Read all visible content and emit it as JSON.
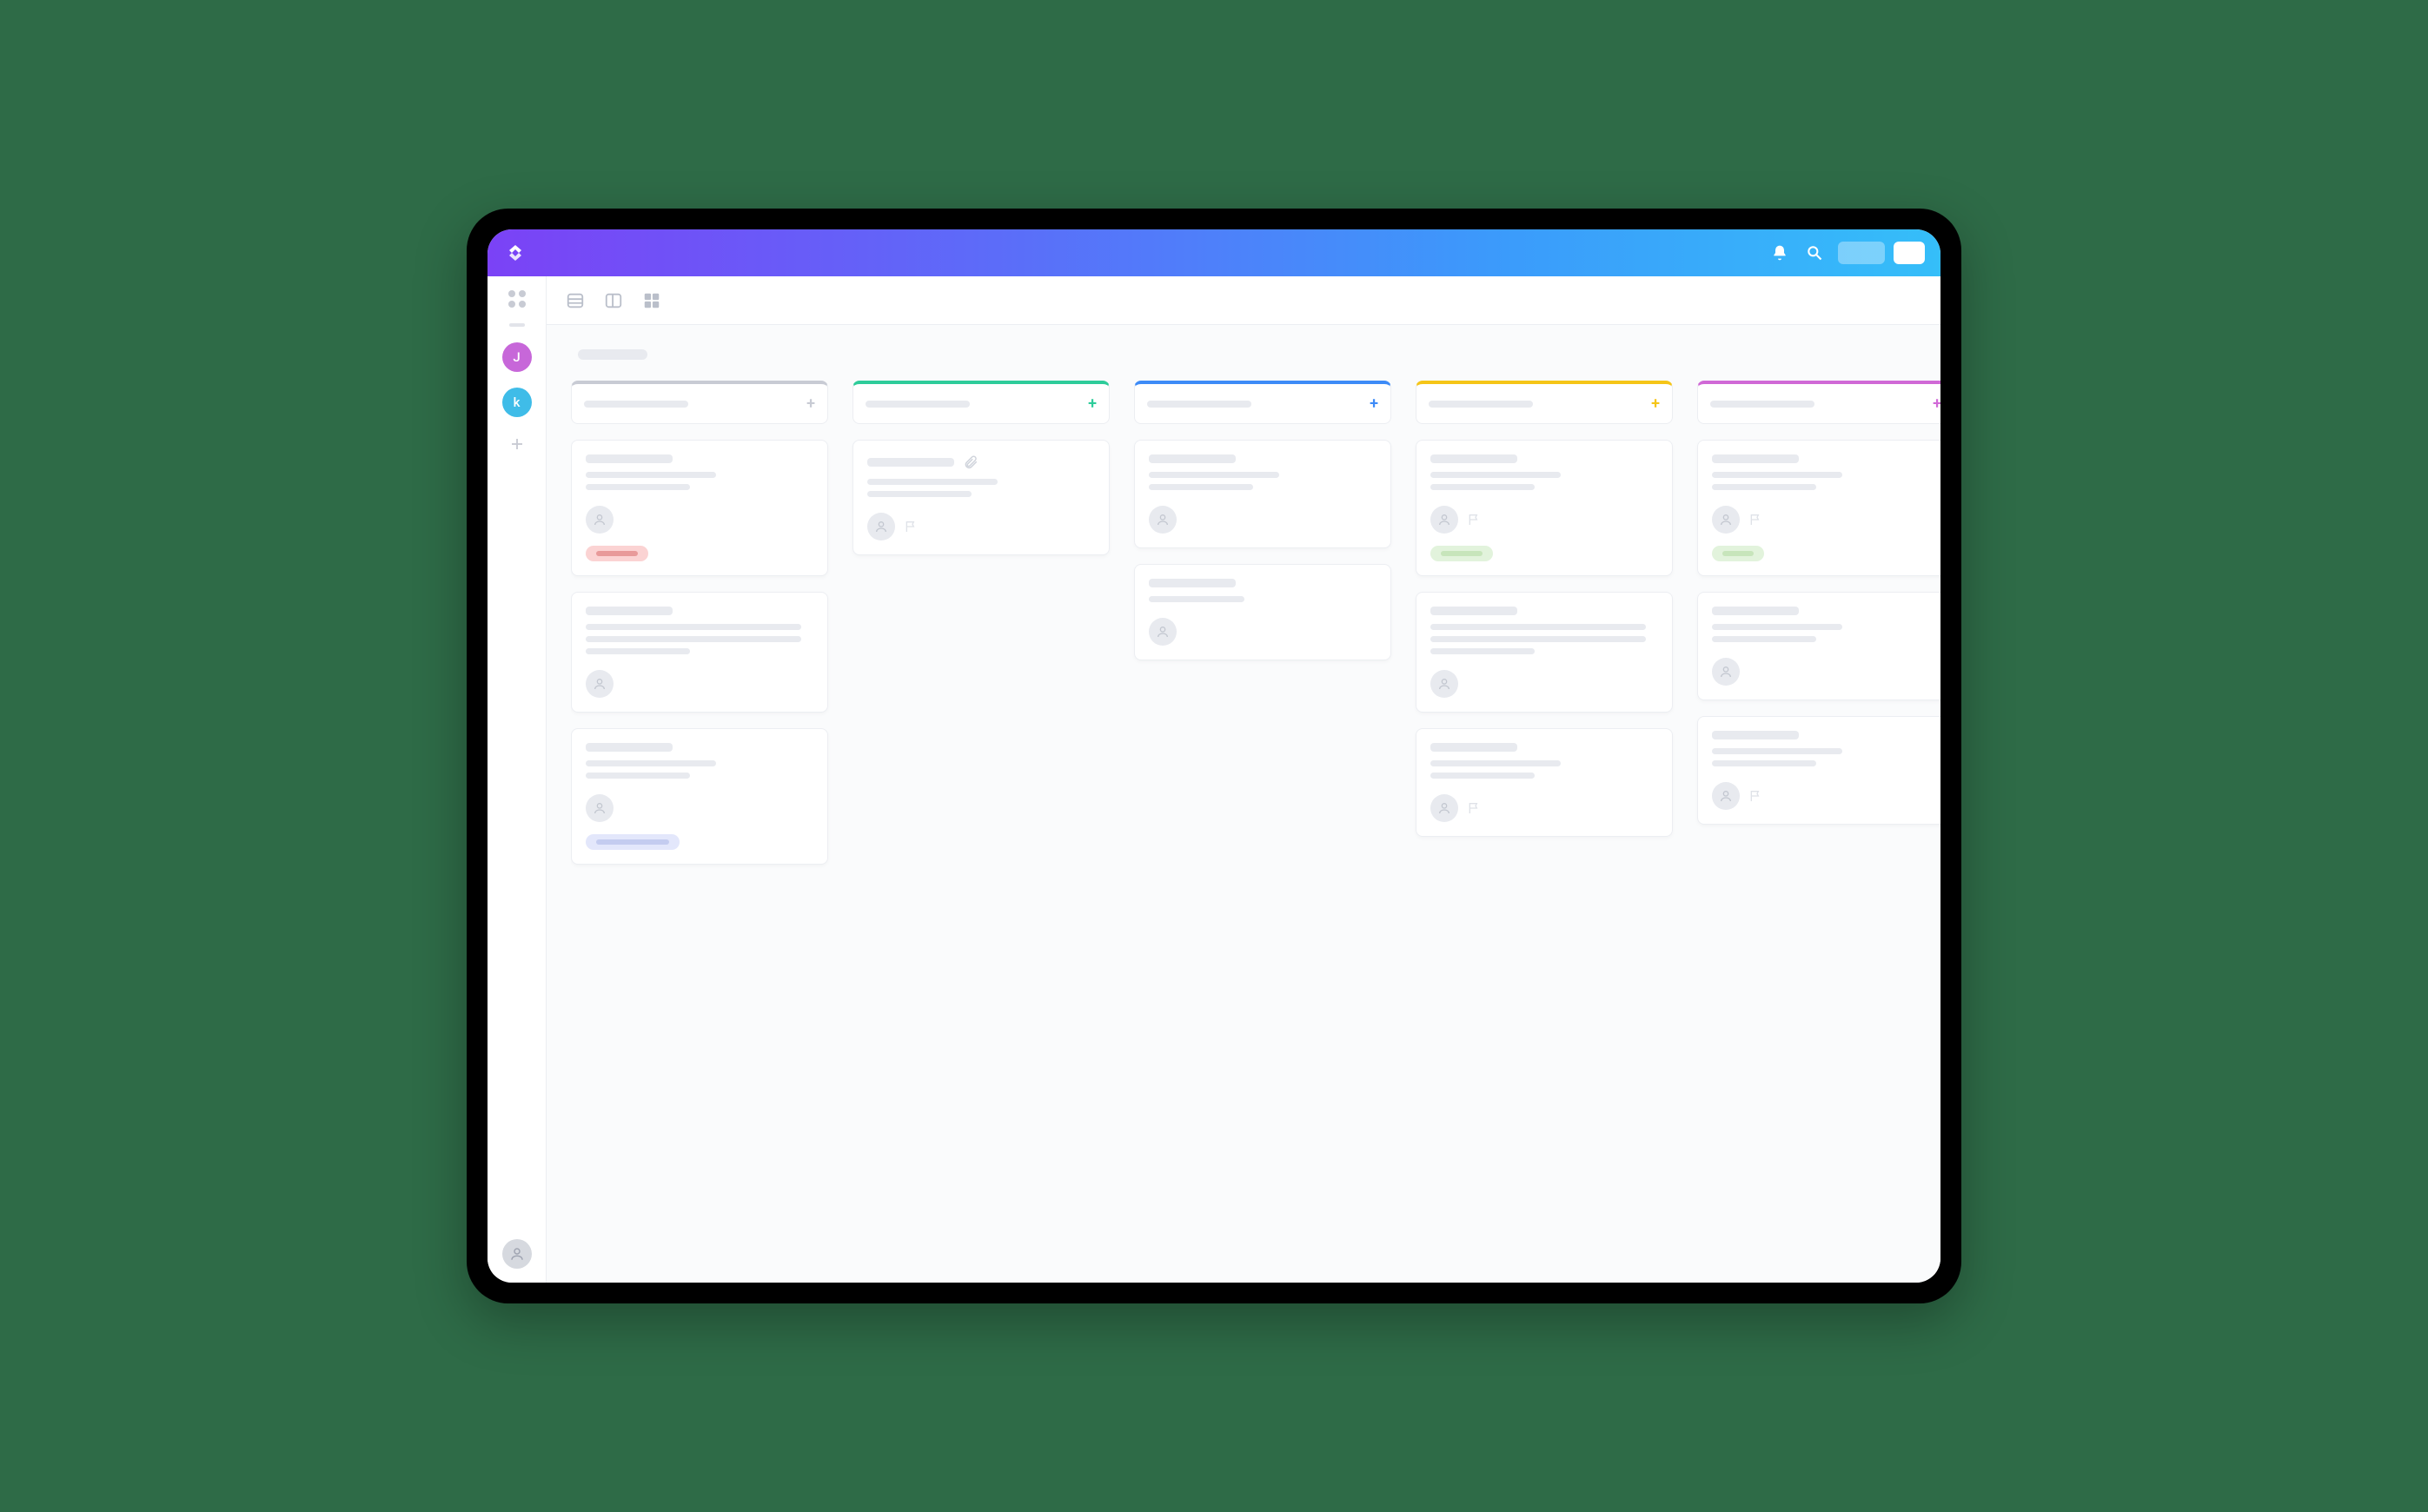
{
  "topbar": {
    "logo_name": "app-logo",
    "notifications_icon": "bell-icon",
    "search_icon": "search-icon"
  },
  "sidebar": {
    "workspaces": [
      {
        "letter": "J",
        "color": "#c767d9"
      },
      {
        "letter": "k",
        "color": "#3fbce8"
      }
    ]
  },
  "view_tabs": {
    "list_icon": "list-view-icon",
    "board_icon": "board-view-icon",
    "grid_icon": "grid-view-icon"
  },
  "board": {
    "title_placeholder": "",
    "columns": [
      {
        "color": "#c8cbd4",
        "plus_color": "#c8cbd4",
        "cards": [
          {
            "lines": 2,
            "has_attachment": false,
            "has_flag": false,
            "tag": {
              "bg": "#fbd3d3",
              "bar": "#e89a9a",
              "w": 48
            }
          },
          {
            "lines": 3,
            "has_attachment": false,
            "has_flag": false,
            "tag": null
          },
          {
            "lines": 2,
            "has_attachment": false,
            "has_flag": false,
            "tag": {
              "bg": "#e3e7fb",
              "bar": "#c4ccf0",
              "w": 84
            }
          }
        ]
      },
      {
        "color": "#2ecc9a",
        "plus_color": "#2ecc9a",
        "cards": [
          {
            "lines": 2,
            "has_attachment": true,
            "has_flag": true,
            "tag": null
          }
        ]
      },
      {
        "color": "#3d8bf7",
        "plus_color": "#3d8bf7",
        "cards": [
          {
            "lines": 2,
            "has_attachment": false,
            "has_flag": false,
            "tag": null
          },
          {
            "lines": 1,
            "short": true,
            "has_attachment": false,
            "has_flag": false,
            "tag": null
          }
        ]
      },
      {
        "color": "#f5c518",
        "plus_color": "#f5c518",
        "cards": [
          {
            "lines": 2,
            "has_attachment": false,
            "has_flag": true,
            "tag": {
              "bg": "#e2f3dc",
              "bar": "#c7e5bb",
              "w": 48
            }
          },
          {
            "lines": 3,
            "has_attachment": false,
            "has_flag": false,
            "tag": null
          },
          {
            "lines": 2,
            "has_attachment": false,
            "has_flag": true,
            "tag": null
          }
        ]
      },
      {
        "color": "#d069d6",
        "plus_color": "#d069d6",
        "cards": [
          {
            "lines": 2,
            "has_attachment": false,
            "has_flag": true,
            "tag": {
              "bg": "#e2f3dc",
              "bar": "#c7e5bb",
              "w": 36
            }
          },
          {
            "lines": 2,
            "has_attachment": false,
            "has_flag": false,
            "tag": null
          },
          {
            "lines": 2,
            "has_attachment": false,
            "has_flag": true,
            "tag": null
          }
        ]
      }
    ]
  }
}
